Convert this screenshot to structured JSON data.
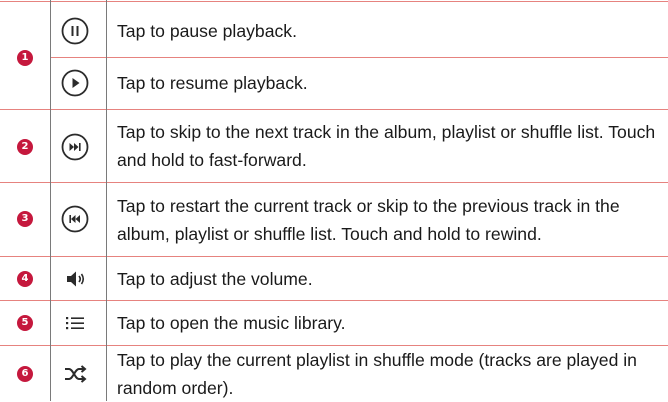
{
  "rows": [
    {
      "num": "1",
      "icon": "pause-icon",
      "text": "Tap to pause playback."
    },
    {
      "num": "",
      "icon": "play-icon",
      "text": "Tap to resume playback."
    },
    {
      "num": "2",
      "icon": "next-track-icon",
      "text": "Tap to skip to the next track in the album, playlist or shuffle list. Touch and hold to fast-forward."
    },
    {
      "num": "3",
      "icon": "previous-track-icon",
      "text": "Tap to restart the current track or skip to the previous track in the album, playlist or shuffle list. Touch and hold to rewind."
    },
    {
      "num": "4",
      "icon": "volume-icon",
      "text": "Tap to adjust the volume."
    },
    {
      "num": "5",
      "icon": "list-icon",
      "text": "Tap to open the music library."
    },
    {
      "num": "6",
      "icon": "shuffle-icon",
      "text": "Tap to play the current playlist in shuffle mode (tracks are played in random order)."
    }
  ],
  "colors": {
    "rule": "#e6837f",
    "badge": "#c5183d",
    "icon": "#2b2b2b"
  }
}
